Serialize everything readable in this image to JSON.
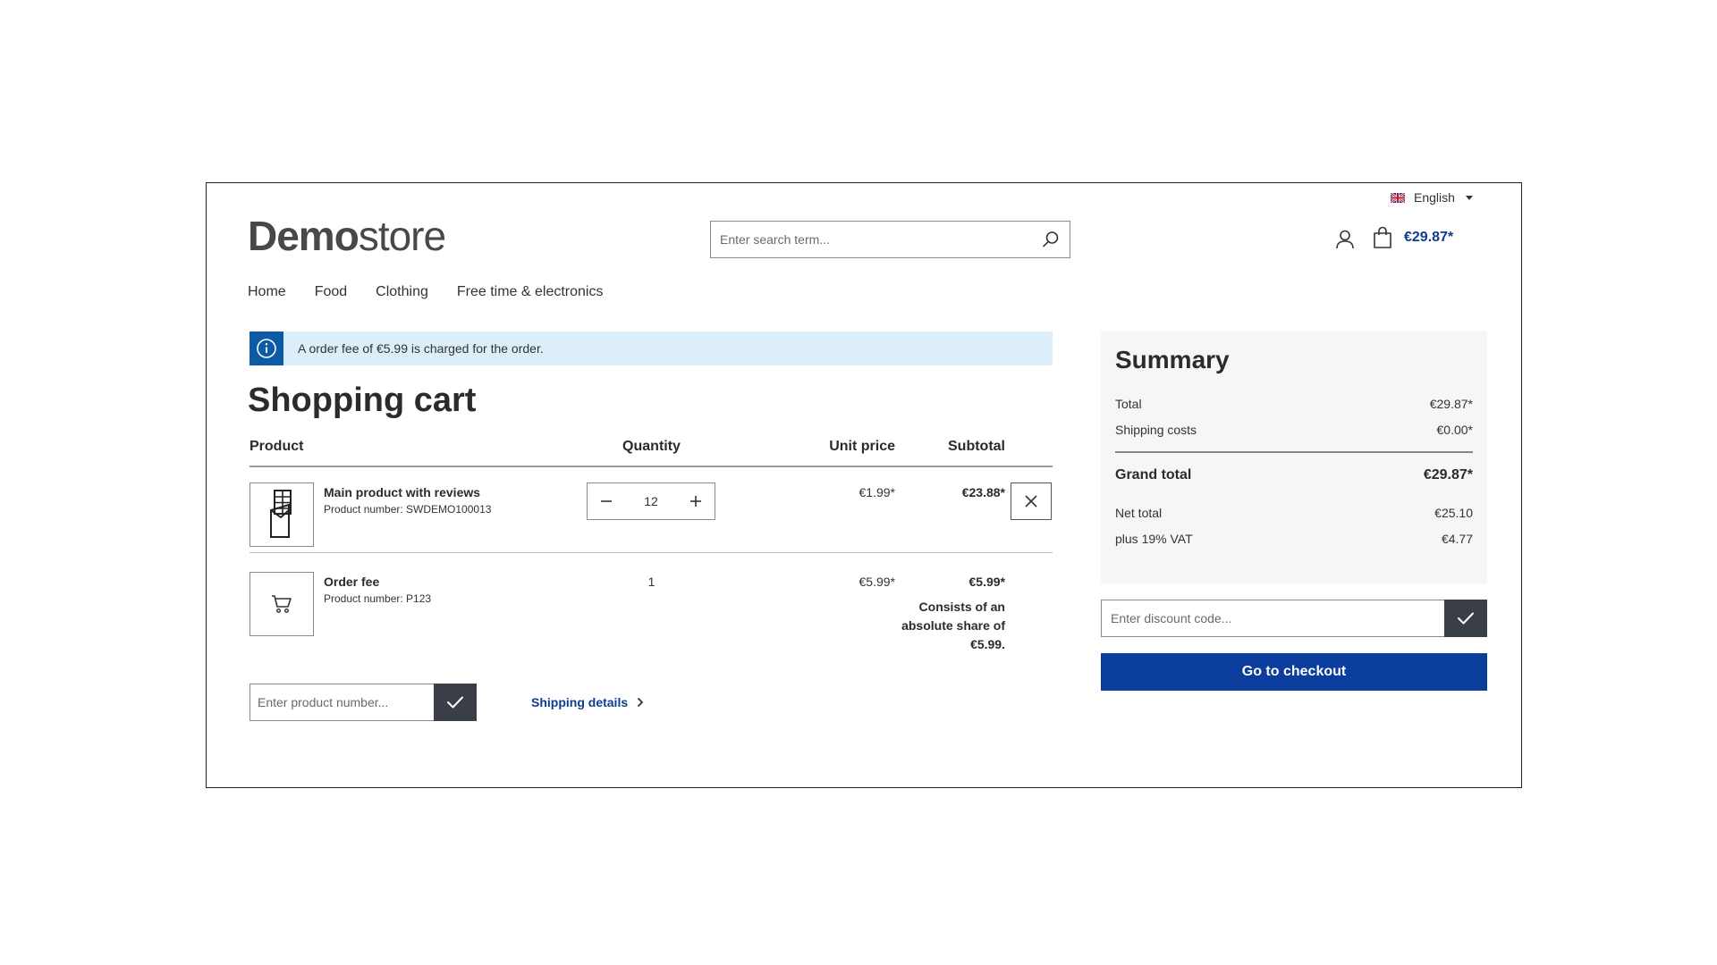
{
  "header": {
    "language": "English",
    "logo_bold": "Demo",
    "logo_light": "store",
    "search_placeholder": "Enter search term...",
    "cart_total": "€29.87*"
  },
  "nav": {
    "items": [
      {
        "label": "Home"
      },
      {
        "label": "Food"
      },
      {
        "label": "Clothing"
      },
      {
        "label": "Free time & electronics"
      }
    ]
  },
  "alert": {
    "text": "A order fee of €5.99 is charged for the order."
  },
  "cart": {
    "title": "Shopping cart",
    "columns": {
      "product": "Product",
      "quantity": "Quantity",
      "unit_price": "Unit price",
      "subtotal": "Subtotal"
    },
    "items": [
      {
        "name": "Main product with reviews",
        "number": "Product number: SWDEMO100013",
        "quantity": "12",
        "unit_price": "€1.99*",
        "subtotal": "€23.88*",
        "icon": "chocolate-icon"
      },
      {
        "name": "Order fee",
        "number": "Product number: P123",
        "quantity": "1",
        "unit_price": "€5.99*",
        "subtotal": "€5.99*",
        "subtotal_note": "Consists of an absolute share of €5.99.",
        "icon": "cart-icon"
      }
    ],
    "add_product_placeholder": "Enter product number...",
    "shipping_details": "Shipping details"
  },
  "summary": {
    "title": "Summary",
    "total_label": "Total",
    "total_value": "€29.87*",
    "shipping_label": "Shipping costs",
    "shipping_value": "€0.00*",
    "grand_total_label": "Grand total",
    "grand_total_value": "€29.87*",
    "net_total_label": "Net total",
    "net_total_value": "€25.10",
    "vat_label": "plus 19% VAT",
    "vat_value": "€4.77",
    "discount_placeholder": "Enter discount code...",
    "checkout_label": "Go to checkout"
  },
  "colors": {
    "primary": "#0a3d9c",
    "info_bg": "#dceefa",
    "info_icon_bg": "#0d5aa7",
    "dark_button": "#3a3f47"
  }
}
